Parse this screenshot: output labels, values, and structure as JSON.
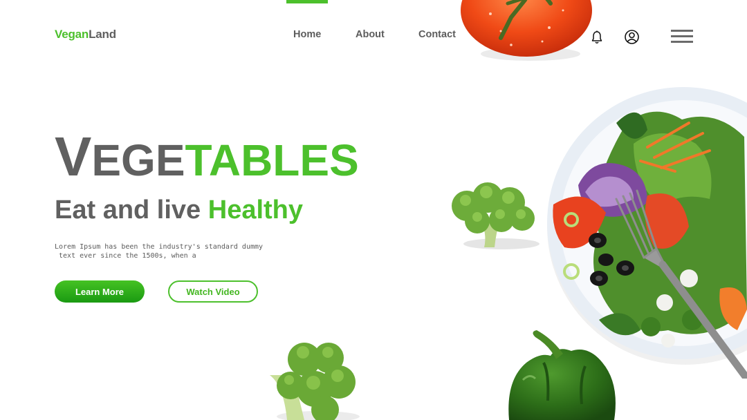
{
  "brand": {
    "part1": "Vegan",
    "part2": "Land"
  },
  "nav": {
    "items": [
      {
        "label": "Home",
        "active": true
      },
      {
        "label": "About"
      },
      {
        "label": "Contact"
      }
    ]
  },
  "header_icons": [
    "bell-icon",
    "user-icon",
    "hamburger-menu-icon"
  ],
  "hero": {
    "title_big_letter": "V",
    "title_part1": "EGE",
    "title_part2": "TABLES",
    "tagline_part1": "Eat and live ",
    "tagline_part2": "Healthy",
    "description_line1": "Lorem Ipsum has been the industry's standard dummy",
    "description_line2": " text ever since the 1500s, when a",
    "primary_button": "Learn More",
    "secondary_button": "Watch Video"
  },
  "colors": {
    "accent": "#4cc02c",
    "text": "#5f5f5f",
    "background": "#ffffff"
  }
}
